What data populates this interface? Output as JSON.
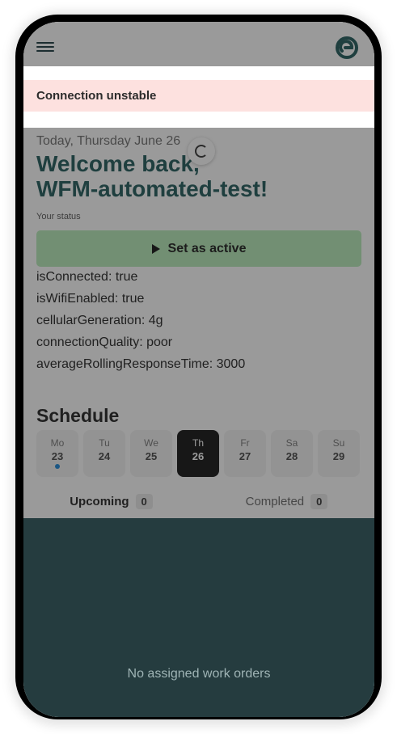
{
  "banner": {
    "message": "Connection unstable"
  },
  "header": {
    "menu_icon": "hamburger-menu-icon",
    "logo_icon": "app-logo-icon"
  },
  "greeting": {
    "date": "Today, Thursday June 26",
    "line1": "Welcome back,",
    "line2": "WFM-automated-test!"
  },
  "status": {
    "label": "Your status",
    "button_label": "Set as active"
  },
  "diagnostics": [
    "isConnected: true",
    "isWifiEnabled: true",
    "cellularGeneration: 4g",
    "connectionQuality: poor",
    "averageRollingResponseTime: 3000"
  ],
  "schedule": {
    "title": "Schedule",
    "days": [
      {
        "name": "Mo",
        "date": "23",
        "has_dot": true,
        "selected": false
      },
      {
        "name": "Tu",
        "date": "24",
        "has_dot": false,
        "selected": false
      },
      {
        "name": "We",
        "date": "25",
        "has_dot": false,
        "selected": false
      },
      {
        "name": "Th",
        "date": "26",
        "has_dot": false,
        "selected": true
      },
      {
        "name": "Fr",
        "date": "27",
        "has_dot": false,
        "selected": false
      },
      {
        "name": "Sa",
        "date": "28",
        "has_dot": false,
        "selected": false
      },
      {
        "name": "Su",
        "date": "29",
        "has_dot": false,
        "selected": false
      }
    ]
  },
  "tabs": {
    "upcoming": {
      "label": "Upcoming",
      "count": "0"
    },
    "completed": {
      "label": "Completed",
      "count": "0"
    }
  },
  "empty_state": "No assigned work orders",
  "colors": {
    "brand_teal": "#1f5a5a",
    "active_button": "#b6ecb8",
    "banner_bg": "#fde1df",
    "dot_blue": "#1a86d8"
  }
}
